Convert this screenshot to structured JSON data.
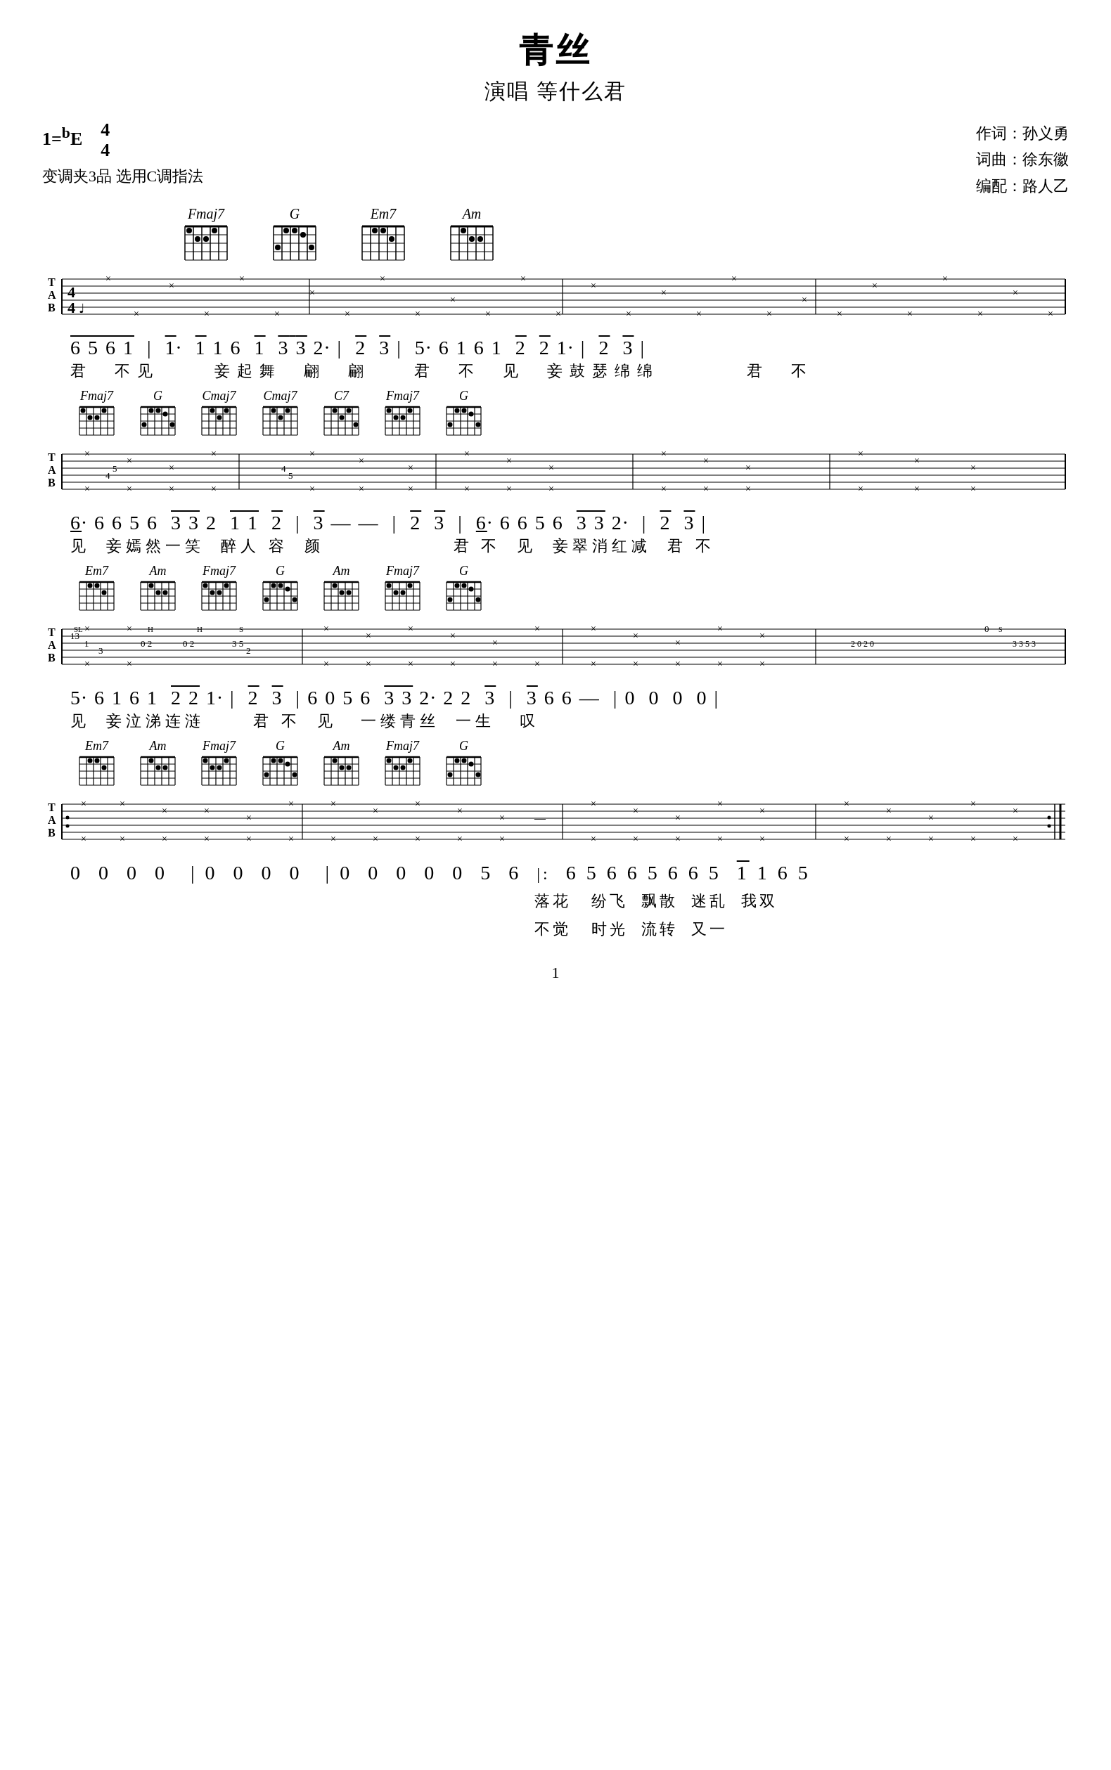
{
  "title": "青丝",
  "artist_line": "演唱  等什么君",
  "key": "1=ᵇE",
  "time_sig": {
    "top": "4",
    "bottom": "4"
  },
  "meta_right": [
    "作词：孙义勇",
    "词曲：徐东徽",
    "编配：路人乙"
  ],
  "capo": "变调夹3品  选用C调指法",
  "chord_row1": [
    "Fmaj7",
    "G",
    "Em7",
    "Am"
  ],
  "chord_row2": [
    "Fmaj7",
    "G",
    "Cmaj7",
    "Cmaj7",
    "C7",
    "Fmaj7",
    "G"
  ],
  "chord_row3": [
    "Em7",
    "Am",
    "Fmaj7",
    "G",
    "Am",
    "Fmaj7",
    "G"
  ],
  "notation_lines": [
    {
      "notes": "6 5 6 1̄ | 1̄· 1̄ 1 6 1̄ 3̄ 3̄ 2· | 2̄ 3̄ | 5· 6 1 6 1 2̄ 2̄ 1· | 2̄ 3̄ |",
      "lyrics": "君  不见　妾起舞  翩  翩  君  不  见  妾鼓瑟绵绵　　君  不"
    },
    {
      "notes": "6· 6 6 5 6 3̄ 3̄ 2 1̄ 1̄ 2̄ | 3̄  —  — | 2̄ 3̄ | 6· 6 6 5 6 3̄ 3̄ 2· | 2̄ 3̄ |",
      "lyrics": "见  妾嫣然一笑  醉人容  颜　　　　　君  不  见  妾翠消红减　君  不"
    },
    {
      "notes": "5· 6 1 6 1 2̄ 2̄ 1· | 2̄ 3̄ | 6  0 5 6 3̄ 3̄ 2· 2 2 3̄ | 3̄ 6 6  —  | 0  0  0  0 |",
      "lyrics": "见  妾泣涕连涟　　君  不  见  一缕青丝  一生　叹"
    },
    {
      "notes": "0  0  0  0 | 0  0  0  0 | 0  0  0  0  0 5 6 |: 6 5 6 6 5 6 6 5 1̄ 1 6 5",
      "lyrics": "落花　纷飞  飘散  迷乱  我双\n不觉  时光  流转  又一"
    }
  ],
  "page_number": "1"
}
